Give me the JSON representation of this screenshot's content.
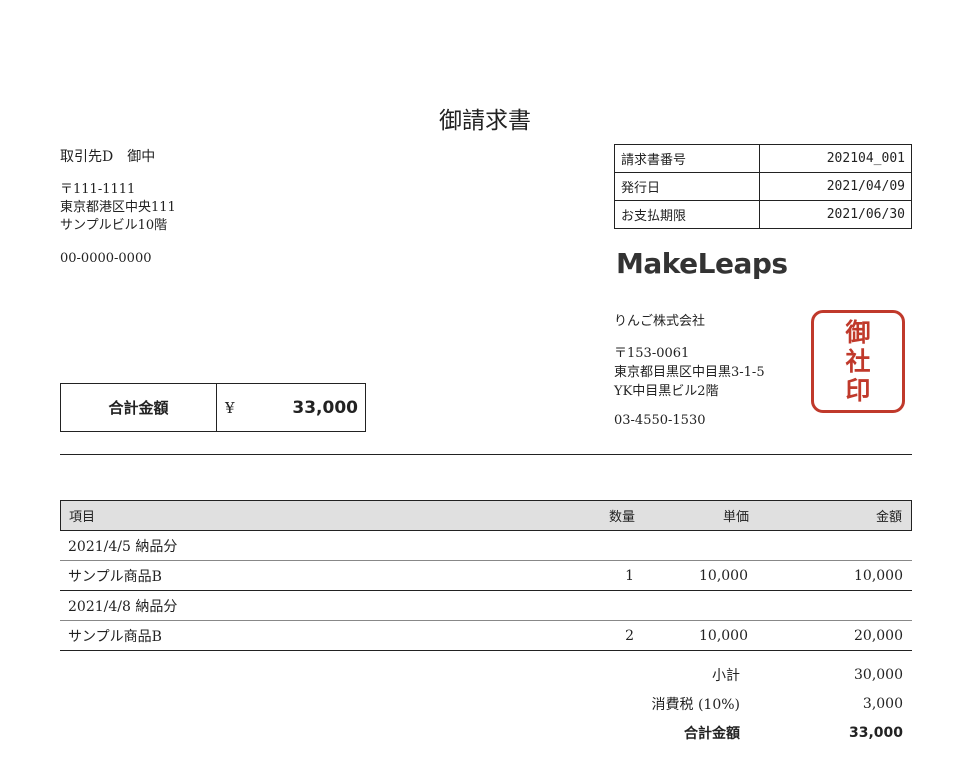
{
  "title": "御請求書",
  "client": {
    "name": "取引先D　御中",
    "zip": "〒111-1111",
    "address1": "東京都港区中央111",
    "address2": "サンプルビル10階",
    "phone": "00-0000-0000"
  },
  "meta": [
    {
      "label": "請求書番号",
      "value": "202104_001"
    },
    {
      "label": "発行日",
      "value": "2021/04/09"
    },
    {
      "label": "お支払期限",
      "value": "2021/06/30"
    }
  ],
  "logo": "MakeLeaps",
  "company": {
    "name": "りんご株式会社",
    "zip": "〒153-0061",
    "address1": "東京都目黒区中目黒3-1-5",
    "address2": "YK中目黒ビル2階",
    "phone": "03-4550-1530"
  },
  "seal": [
    "御",
    "社",
    "印"
  ],
  "total_box": {
    "label": "合計金額",
    "currency": "¥",
    "amount": "33,000"
  },
  "items_header": {
    "name": "項目",
    "qty": "数量",
    "unit": "単価",
    "amount": "金額"
  },
  "rows": [
    {
      "name": "2021/4/5 納品分",
      "qty": "",
      "unit": "",
      "amount": ""
    },
    {
      "name": "サンプル商品B",
      "qty": "1",
      "unit": "10,000",
      "amount": "10,000"
    },
    {
      "name": "2021/4/8 納品分",
      "qty": "",
      "unit": "",
      "amount": ""
    },
    {
      "name": "サンプル商品B",
      "qty": "2",
      "unit": "10,000",
      "amount": "20,000"
    }
  ],
  "summary": {
    "subtotal_label": "小計",
    "subtotal": "30,000",
    "tax_label": "消費税 (10%)",
    "tax": "3,000",
    "total_label": "合計金額",
    "total": "33,000"
  }
}
